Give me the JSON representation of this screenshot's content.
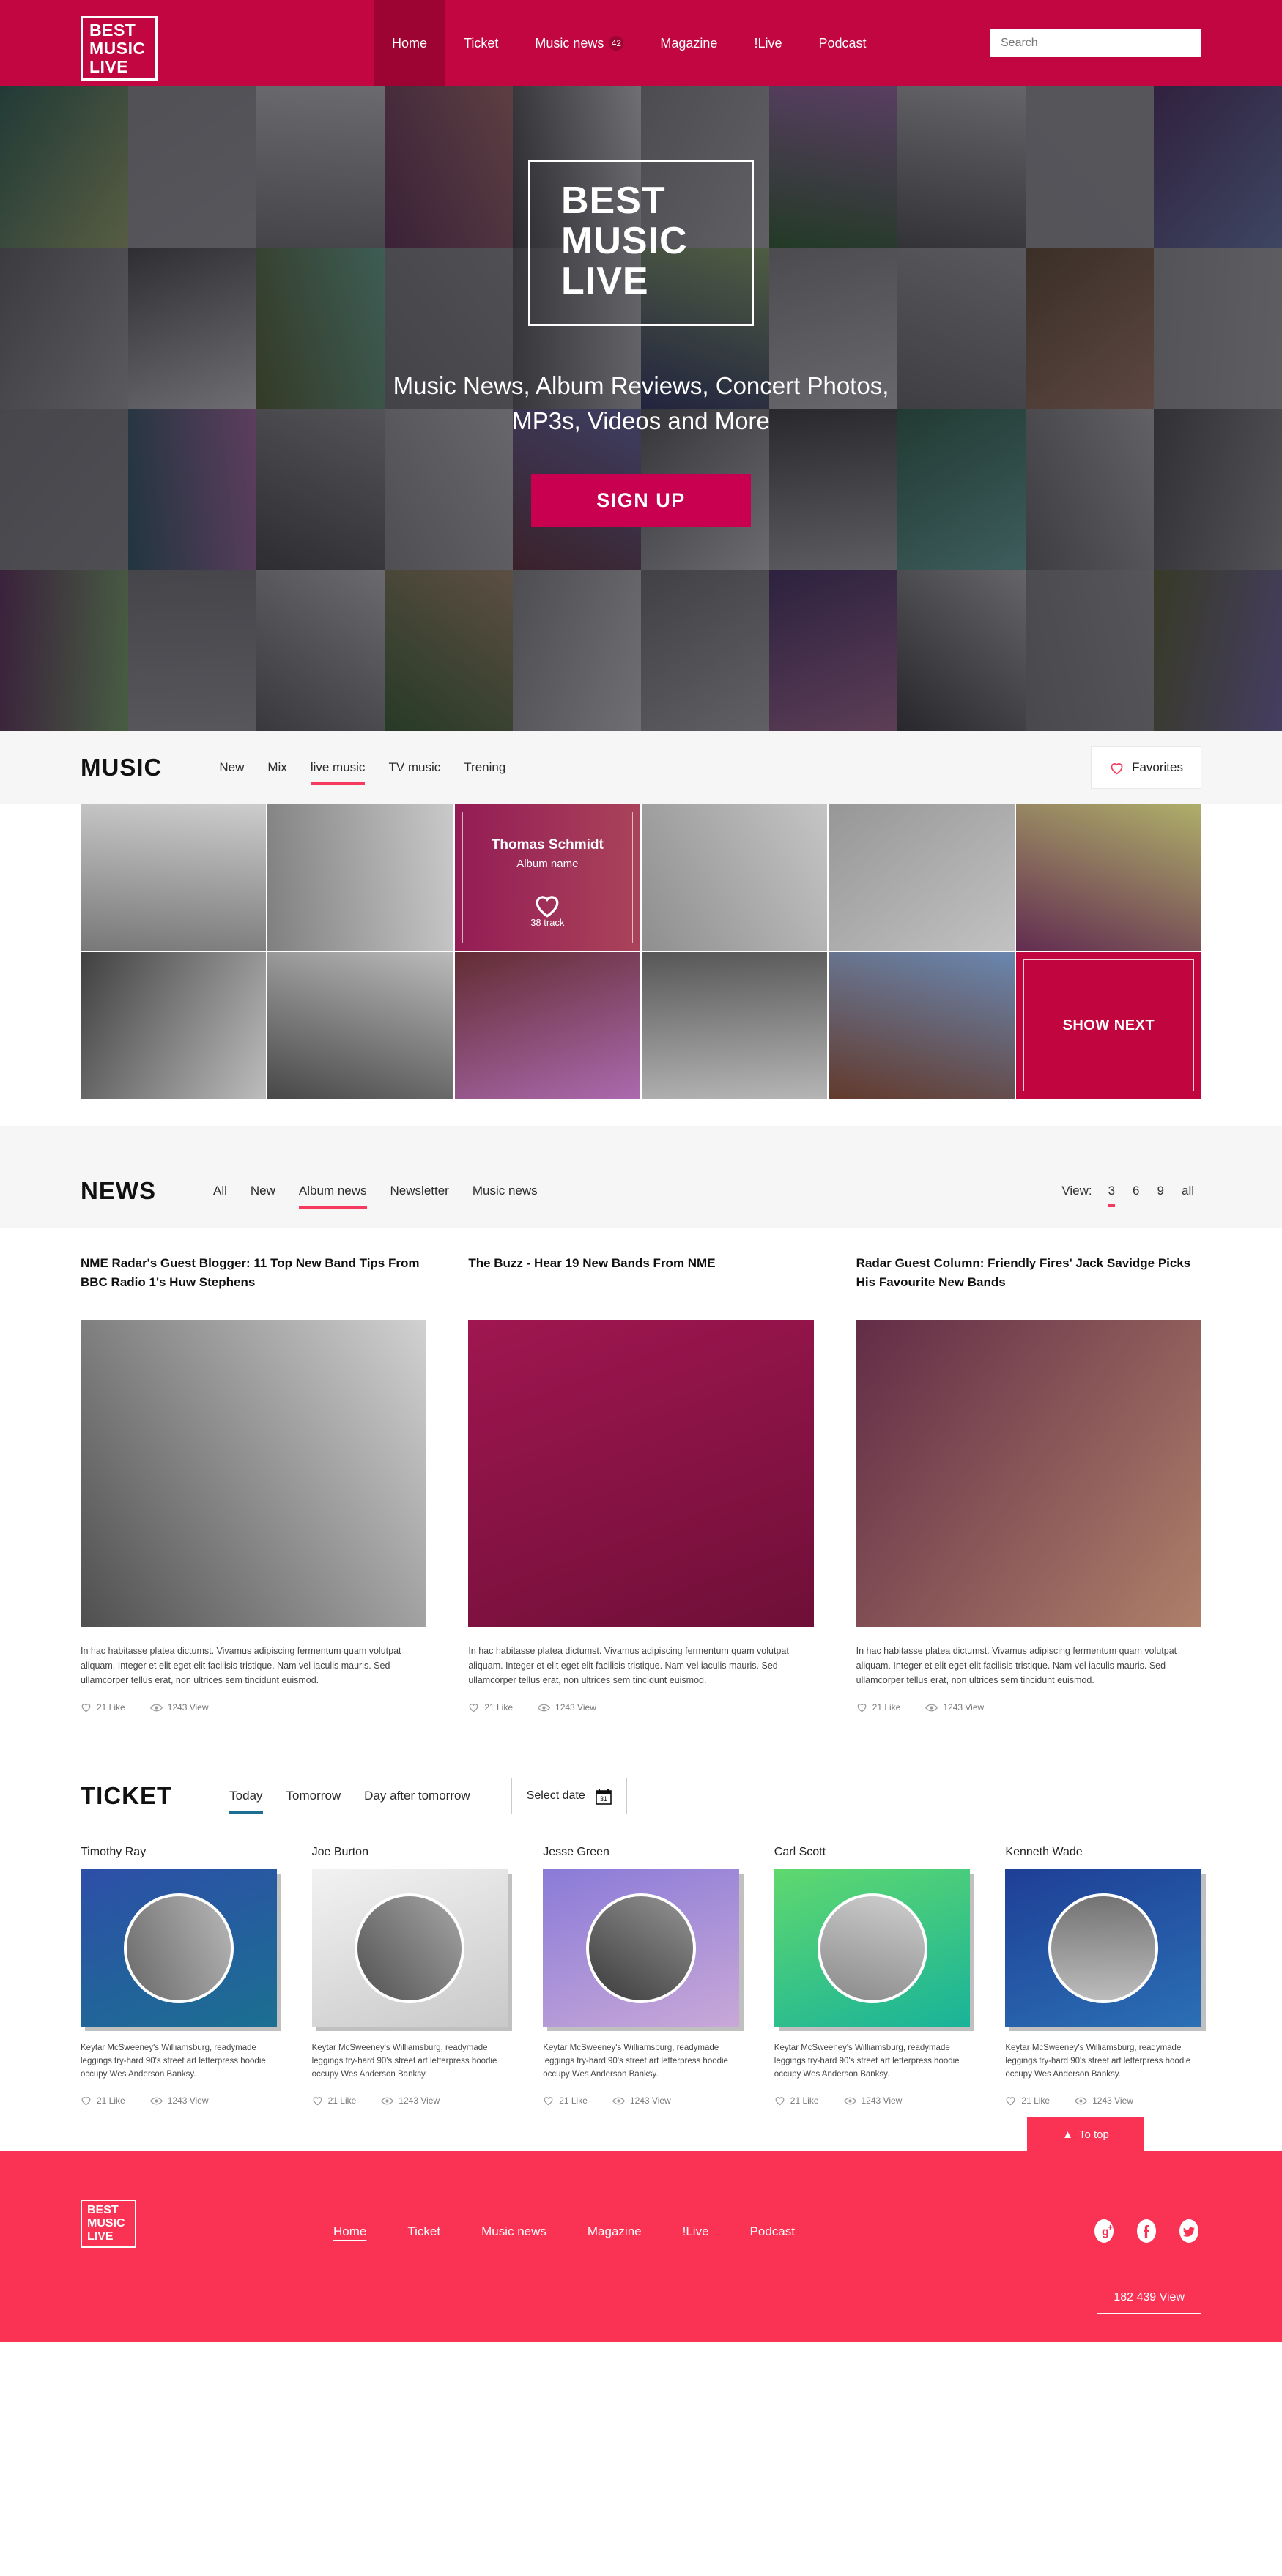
{
  "brand": {
    "line1": "BEST",
    "line2": "MUSIC",
    "line3": "LIVE"
  },
  "header": {
    "nav": [
      {
        "label": "Home",
        "active": true,
        "badge": ""
      },
      {
        "label": "Ticket",
        "active": false,
        "badge": ""
      },
      {
        "label": "Music news",
        "active": false,
        "badge": "42"
      },
      {
        "label": "Magazine",
        "active": false,
        "badge": ""
      },
      {
        "label": "!Live",
        "active": false,
        "badge": ""
      },
      {
        "label": "Podcast",
        "active": false,
        "badge": ""
      }
    ],
    "search_placeholder": "Search",
    "search_value": "",
    "bg_color": "#c10641",
    "active_bg_color": "#9d0433"
  },
  "hero": {
    "title_line1": "BEST",
    "title_line2": "MUSIC",
    "title_line3": "LIVE",
    "subtitle": "Music News, Album Reviews, Concert Photos, MP3s, Videos and More",
    "cta_label": "SIGN UP",
    "cta_color": "#c8004f"
  },
  "music": {
    "title": "MUSIC",
    "tabs": [
      {
        "label": "New",
        "active": false
      },
      {
        "label": "Mix",
        "active": false
      },
      {
        "label": "live music",
        "active": true
      },
      {
        "label": "TV music",
        "active": false
      },
      {
        "label": "Trening",
        "active": false
      }
    ],
    "favorites_label": "Favorites",
    "accent_color": "#f43a5e",
    "album_card": {
      "artist": "Thomas Schmidt",
      "album_name": "Album name",
      "tracks": "38 track",
      "bg_color": "#cc0a4d"
    },
    "show_next_label": "SHOW NEXT",
    "tiles_row1": [
      "photo-1",
      "photo-2",
      "album-card",
      "photo-3",
      "photo-4",
      "photo-5"
    ],
    "tiles_row2": [
      "photo-6",
      "photo-7",
      "photo-8",
      "photo-9",
      "photo-10",
      "show-next"
    ]
  },
  "news": {
    "title": "NEWS",
    "tabs": [
      {
        "label": "All",
        "active": false
      },
      {
        "label": "New",
        "active": false
      },
      {
        "label": "Album news",
        "active": true
      },
      {
        "label": "Newsletter",
        "active": false
      },
      {
        "label": "Music news",
        "active": false
      }
    ],
    "view_label": "View:",
    "view_options": [
      {
        "label": "3",
        "active": true
      },
      {
        "label": "6",
        "active": false
      },
      {
        "label": "9",
        "active": false
      },
      {
        "label": "all",
        "active": false
      }
    ],
    "body_text": "In hac habitasse platea dictumst. Vivamus adipiscing fermentum quam volutpat aliquam. Integer et elit eget elit facilisis tristique. Nam vel iaculis mauris. Sed ullamcorper tellus erat, non ultrices sem tincidunt euismod.",
    "likes": "21 Like",
    "views": "1243 View",
    "cards": [
      {
        "title": "NME Radar's Guest Blogger: 11 Top New Band Tips From BBC Radio 1's Huw Stephens"
      },
      {
        "title": "The Buzz - Hear 19 New Bands From NME"
      },
      {
        "title": "Radar Guest Column: Friendly Fires' Jack Savidge Picks His Favourite New Bands"
      }
    ]
  },
  "ticket": {
    "title": "TICKET",
    "tabs": [
      {
        "label": "Today",
        "active": true
      },
      {
        "label": "Tomorrow",
        "active": false
      },
      {
        "label": "Day after tomorrow",
        "active": false
      }
    ],
    "active_color": "#1b6f92",
    "select_date_label": "Select date",
    "body_text": "Keytar McSweeney's Williamsburg, readymade leggings try-hard 90's street art letterpress hoodie occupy Wes Anderson Banksy.",
    "likes": "21 Like",
    "views": "1243 View",
    "cards": [
      {
        "name": "Timothy Ray",
        "color_top": "#2d4fa8",
        "color_bottom": "#1b6f92"
      },
      {
        "name": "Joe Burton",
        "color_top": "#f2f2f2",
        "color_bottom": "#c9c9c9"
      },
      {
        "name": "Jesse Green",
        "color_top": "#8a7bd8",
        "color_bottom": "#c9a8d8"
      },
      {
        "name": "Carl Scott",
        "color_top": "#5fd86e",
        "color_bottom": "#19b39a"
      },
      {
        "name": "Kenneth Wade",
        "color_top": "#1e3f96",
        "color_bottom": "#2b6fb5"
      }
    ]
  },
  "footer": {
    "to_top_label": "To top",
    "bg_color": "#fa3355",
    "nav": [
      {
        "label": "Home",
        "active": true
      },
      {
        "label": "Ticket",
        "active": false
      },
      {
        "label": "Music news",
        "active": false
      },
      {
        "label": "Magazine",
        "active": false
      },
      {
        "label": "!Live",
        "active": false
      },
      {
        "label": "Podcast",
        "active": false
      }
    ],
    "social": [
      "google-plus-icon",
      "facebook-icon",
      "twitter-icon"
    ],
    "view_counter": "182 439 View"
  }
}
